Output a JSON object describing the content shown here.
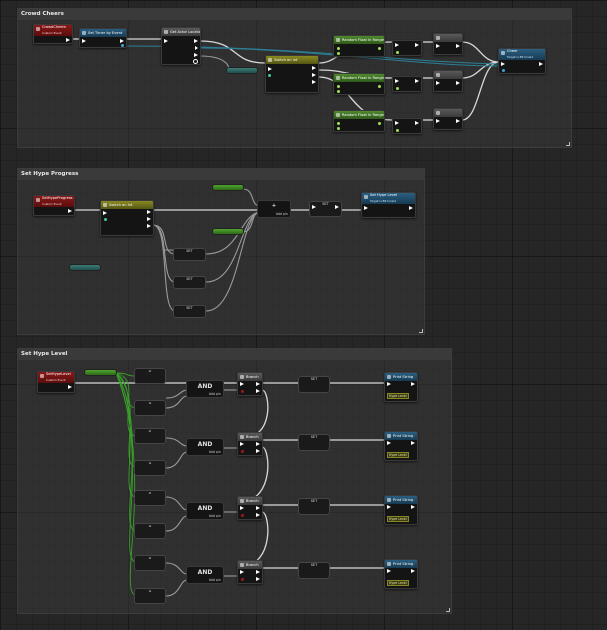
{
  "comments": {
    "crowd_cheers": "Crowd Cheers",
    "set_hype_progress": "Set Hype Progress",
    "set_hype_level": "Set Hype Level"
  },
  "crowd_cheers": {
    "event_title": "CrowdCheers",
    "event_subtitle": "Custom Event",
    "set_timer_title": "Set Timer by Event",
    "get_world_title": "Get Actor Location",
    "switch_title": "Switch on Int",
    "random_float_1": "Random Float in Range",
    "random_float_2": "Random Float in Range",
    "random_float_3": "Random Float in Range",
    "cheer_title": "Cheer",
    "cheer_subtitle": "Target is BP Crowd"
  },
  "set_hype_progress": {
    "event_title": "SetHypeProgress",
    "event_subtitle": "Custom Event",
    "switch_title": "Switch on Int",
    "set_hype_title": "Set Hype Level",
    "set_hype_subtitle": "Target is BP Crowd",
    "add_pin_label": "Add pin",
    "set_label": "SET"
  },
  "set_hype_level": {
    "event_title": "SetHypeLevel",
    "event_subtitle": "Custom Event",
    "and_label": "AND",
    "add_pin_label": "Add pin",
    "branch_label": "Branch",
    "set_label": "SET",
    "print_label": "Print String",
    "print_value": "Hype Level",
    "compare_label": "≥",
    "compare_label_2": "≤"
  }
}
